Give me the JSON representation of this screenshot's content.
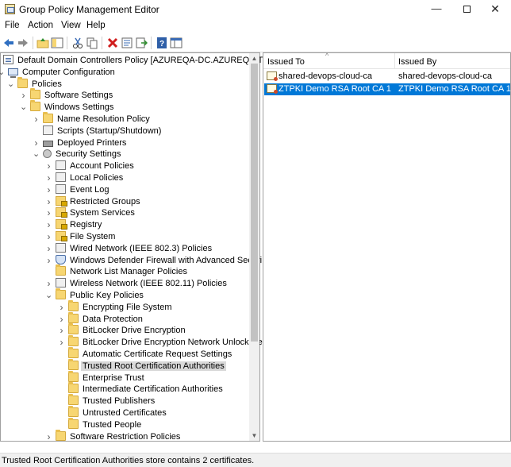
{
  "window": {
    "title": "Group Policy Management Editor",
    "minimize": "—",
    "close": "✕"
  },
  "menu": [
    "File",
    "Action",
    "View",
    "Help"
  ],
  "toolbar_icons": [
    "back-arrow-icon",
    "forward-arrow-icon",
    "up-folder-icon",
    "show-hide-tree-icon",
    "cut-icon",
    "copy-icon",
    "delete-icon",
    "properties-icon",
    "export-list-icon",
    "help-icon",
    "console-view-icon"
  ],
  "tree": [
    {
      "label": "Default Domain Controllers Policy [AZUREQA-DC.AZUREQA.TRUUA",
      "icon": "policy-doc",
      "chevron": ""
    },
    {
      "label": "Computer Configuration",
      "icon": "computer",
      "chevron": "expanded"
    },
    {
      "label": "Policies",
      "icon": "folder",
      "chevron": "expanded"
    },
    {
      "label": "Software Settings",
      "icon": "folder",
      "chevron": "collapsed"
    },
    {
      "label": "Windows Settings",
      "icon": "folder",
      "chevron": "expanded"
    },
    {
      "label": "Name Resolution Policy",
      "icon": "folder",
      "chevron": "collapsed"
    },
    {
      "label": "Scripts (Startup/Shutdown)",
      "icon": "netdoc",
      "chevron": ""
    },
    {
      "label": "Deployed Printers",
      "icon": "printer",
      "chevron": "collapsed"
    },
    {
      "label": "Security Settings",
      "icon": "gear",
      "chevron": "expanded"
    },
    {
      "label": "Account Policies",
      "icon": "netdoc",
      "chevron": "collapsed"
    },
    {
      "label": "Local Policies",
      "icon": "netdoc",
      "chevron": "collapsed"
    },
    {
      "label": "Event Log",
      "icon": "netdoc",
      "chevron": "collapsed"
    },
    {
      "label": "Restricted Groups",
      "icon": "lockfolder",
      "chevron": "collapsed"
    },
    {
      "label": "System Services",
      "icon": "lockfolder",
      "chevron": "collapsed"
    },
    {
      "label": "Registry",
      "icon": "lockfolder",
      "chevron": "collapsed"
    },
    {
      "label": "File System",
      "icon": "lockfolder",
      "chevron": "collapsed"
    },
    {
      "label": "Wired Network (IEEE 802.3) Policies",
      "icon": "netdoc",
      "chevron": "collapsed"
    },
    {
      "label": "Windows Defender Firewall with Advanced Securi",
      "icon": "shield",
      "chevron": "collapsed"
    },
    {
      "label": "Network List Manager Policies",
      "icon": "folder",
      "chevron": ""
    },
    {
      "label": "Wireless Network (IEEE 802.11) Policies",
      "icon": "netdoc",
      "chevron": "collapsed"
    },
    {
      "label": "Public Key Policies",
      "icon": "folder",
      "chevron": "expanded"
    },
    {
      "label": "Encrypting File System",
      "icon": "folder",
      "chevron": "collapsed"
    },
    {
      "label": "Data Protection",
      "icon": "folder",
      "chevron": "collapsed"
    },
    {
      "label": "BitLocker Drive Encryption",
      "icon": "folder",
      "chevron": "collapsed"
    },
    {
      "label": "BitLocker Drive Encryption Network Unlock Ce",
      "icon": "folder",
      "chevron": "collapsed"
    },
    {
      "label": "Automatic Certificate Request Settings",
      "icon": "folder",
      "chevron": ""
    },
    {
      "label": "Trusted Root Certification Authorities",
      "icon": "folder",
      "chevron": "",
      "selected": true
    },
    {
      "label": "Enterprise Trust",
      "icon": "folder",
      "chevron": ""
    },
    {
      "label": "Intermediate Certification Authorities",
      "icon": "folder",
      "chevron": ""
    },
    {
      "label": "Trusted Publishers",
      "icon": "folder",
      "chevron": ""
    },
    {
      "label": "Untrusted Certificates",
      "icon": "folder",
      "chevron": ""
    },
    {
      "label": "Trusted People",
      "icon": "folder",
      "chevron": ""
    },
    {
      "label": "Software Restriction Policies",
      "icon": "folder",
      "chevron": "collapsed"
    }
  ],
  "list": {
    "columns": [
      "Issued To",
      "Issued By"
    ],
    "rows": [
      {
        "issued_to": "shared-devops-cloud-ca",
        "issued_by": "shared-devops-cloud-ca"
      },
      {
        "issued_to": "ZTPKI Demo RSA Root CA 1",
        "issued_by": "ZTPKI Demo RSA Root CA 1",
        "selected": true
      }
    ]
  },
  "status": "Trusted Root Certification Authorities store contains 2 certificates.",
  "colors": {
    "selection": "#0078d7",
    "tree_selection": "#d9d9d9",
    "folder": "#f7d672"
  }
}
